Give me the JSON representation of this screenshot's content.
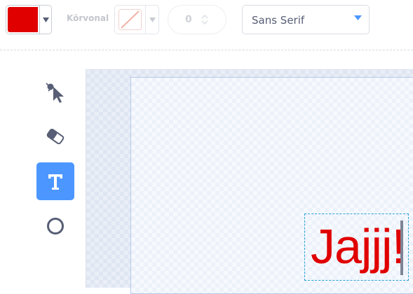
{
  "toolbar": {
    "fill": {
      "color": "#e00000",
      "icon": "chevron-down-icon"
    },
    "outline": {
      "label": "Körvonal",
      "color": "none",
      "icon": "chevron-down-icon"
    },
    "outline_width": {
      "value": "0"
    },
    "font": {
      "selected": "Sans Serif",
      "icon": "caret-down-icon"
    }
  },
  "tools": [
    {
      "name": "select",
      "icon": "reshape-pointer-icon",
      "active": false
    },
    {
      "name": "eraser",
      "icon": "eraser-icon",
      "active": false
    },
    {
      "name": "text",
      "icon": "text-t-icon",
      "active": true
    },
    {
      "name": "circle",
      "icon": "circle-icon",
      "active": false
    }
  ],
  "canvas": {
    "text_item": {
      "content": "Jajjj!",
      "color": "#e00000"
    }
  },
  "colors": {
    "accent": "#4c97ff",
    "icon_gray": "#575e75",
    "selection": "#2aa4d5"
  }
}
